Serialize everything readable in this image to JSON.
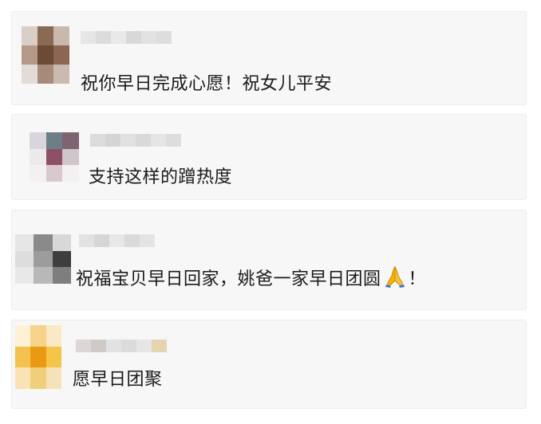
{
  "comments": [
    {
      "text": "祝你早日完成心愿！祝女儿平安",
      "emoji_suffix": "",
      "tail": ""
    },
    {
      "text": "支持这样的蹭热度",
      "emoji_suffix": "",
      "tail": ""
    },
    {
      "text": "祝福宝贝早日回家，姚爸一家早日团圆",
      "emoji_suffix": "folded-hands",
      "tail": "！"
    },
    {
      "text": "愿早日团聚",
      "emoji_suffix": "",
      "tail": ""
    }
  ]
}
